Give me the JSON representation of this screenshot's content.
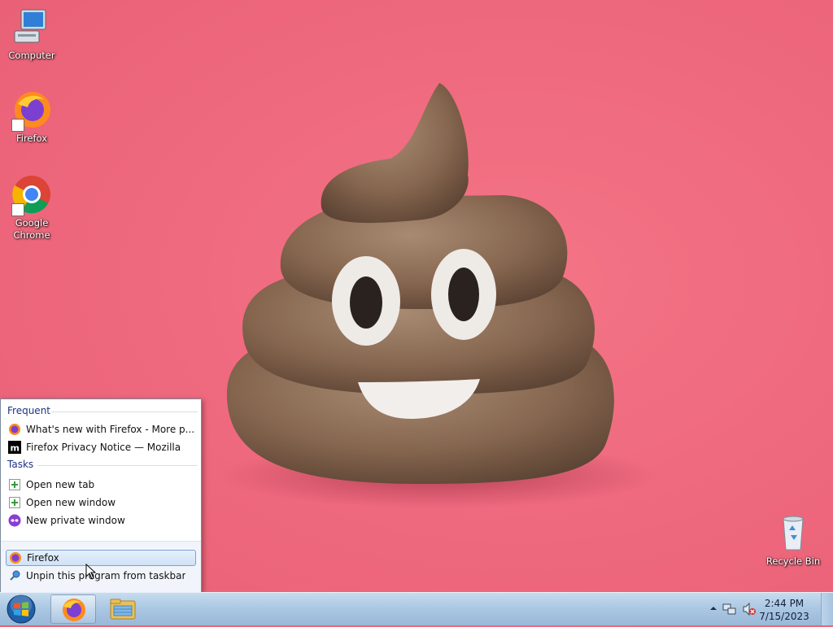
{
  "desktop": {
    "icons": [
      {
        "label": "Computer"
      },
      {
        "label": "Firefox"
      },
      {
        "label": "Google\nChrome"
      },
      {
        "label": "Recycle Bin"
      }
    ]
  },
  "jumplist": {
    "frequent_header": "Frequent",
    "frequent_items": [
      {
        "label": "What's new with Firefox - More p...",
        "icon": "firefox-icon"
      },
      {
        "label": "Firefox Privacy Notice — Mozilla",
        "icon": "mozilla-m-icon"
      }
    ],
    "tasks_header": "Tasks",
    "tasks": [
      {
        "label": "Open new tab",
        "icon": "new-tab-icon"
      },
      {
        "label": "Open new window",
        "icon": "new-window-icon"
      },
      {
        "label": "New private window",
        "icon": "private-mask-icon"
      }
    ],
    "footer_items": [
      {
        "label": "Firefox",
        "icon": "firefox-icon"
      },
      {
        "label": "Unpin this program from taskbar",
        "icon": "unpin-icon"
      }
    ]
  },
  "taskbar": {
    "pinned": [
      "firefox-icon",
      "file-explorer-icon"
    ],
    "clock_time": "2:44 PM",
    "clock_date": "7/15/2023",
    "tray_icons": [
      "show-hidden-icons-arrow",
      "network-icon",
      "volume-muted-icon"
    ]
  },
  "colors": {
    "wallpaper": "#ef6a7f",
    "jumplist_header": "#1e3287",
    "taskbar": "#a9c6e2"
  }
}
